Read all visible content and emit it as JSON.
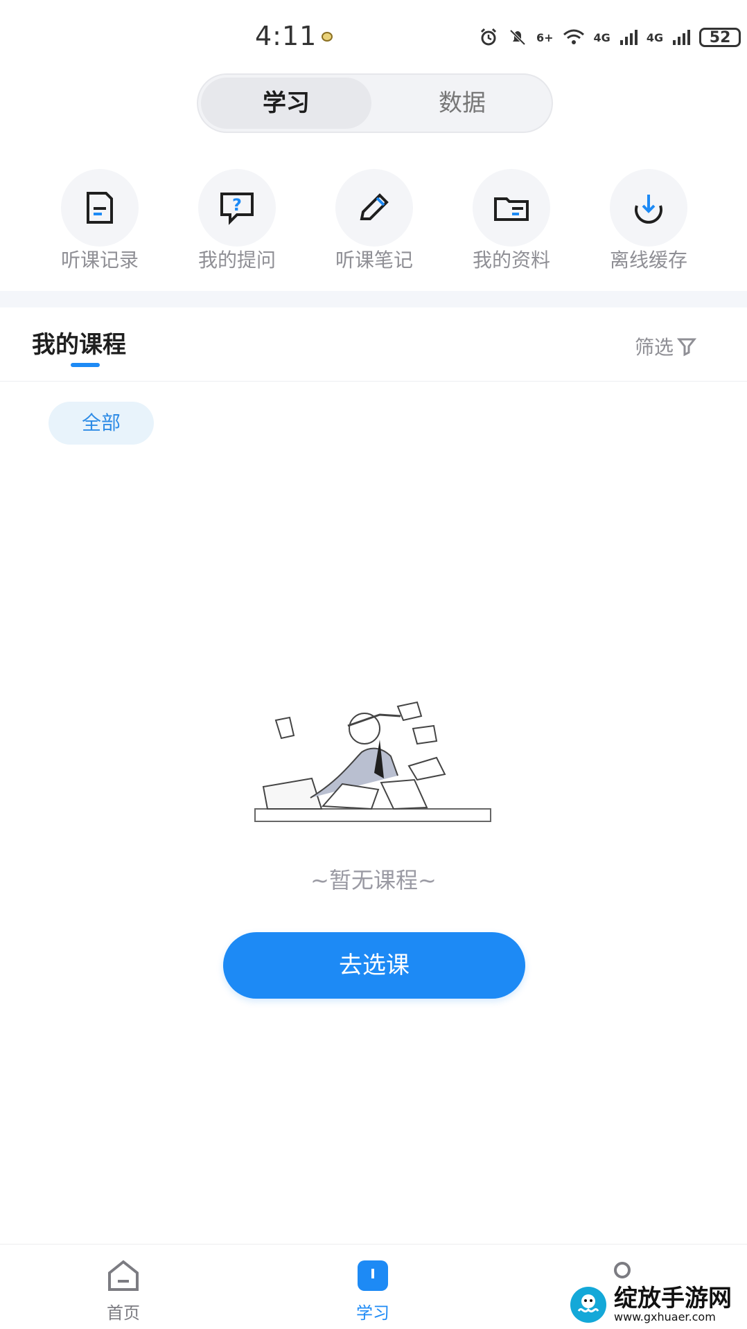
{
  "status_bar": {
    "time": "4:11",
    "network_1": "6+",
    "network_2": "4G",
    "network_3": "4G",
    "battery": "52"
  },
  "segment": {
    "study": "学习",
    "data": "数据"
  },
  "tools": [
    {
      "label": "听课记录",
      "icon": "document-icon"
    },
    {
      "label": "我的提问",
      "icon": "question-bubble-icon"
    },
    {
      "label": "听课笔记",
      "icon": "pencil-icon"
    },
    {
      "label": "我的资料",
      "icon": "folder-icon"
    },
    {
      "label": "离线缓存",
      "icon": "download-icon"
    }
  ],
  "courses": {
    "title": "我的课程",
    "filter": "筛选",
    "chip_all": "全部",
    "empty_text": "~暂无课程~",
    "choose_button": "去选课"
  },
  "bottom_nav": {
    "home": "首页",
    "study": "学习",
    "profile": ""
  },
  "watermark": {
    "brand": "绽放手游网",
    "url": "www.gxhuaer.com"
  },
  "colors": {
    "accent": "#1d8af5",
    "text_dark": "#1f1f1f",
    "text_gray": "#8f8f95"
  }
}
